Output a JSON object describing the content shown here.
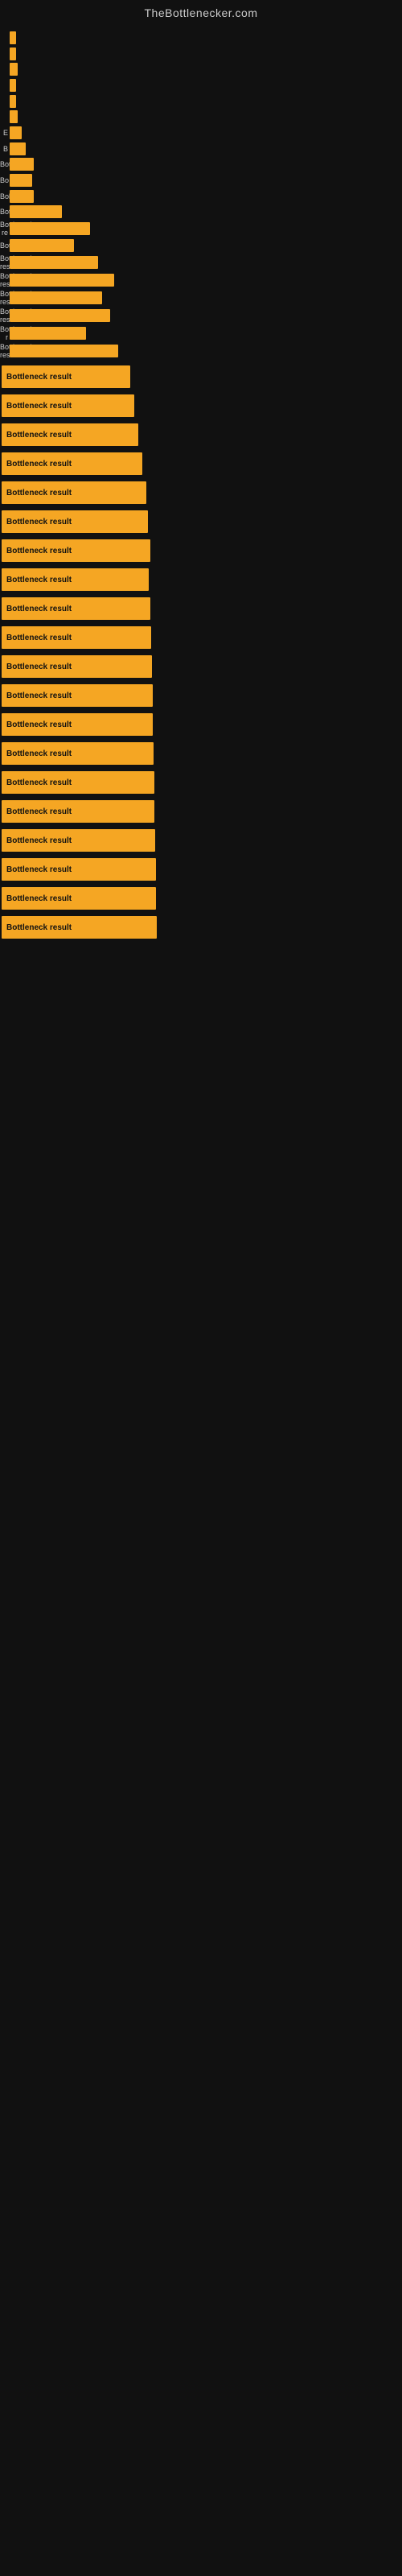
{
  "site": {
    "title": "TheBottlenecker.com"
  },
  "chart": {
    "bars": [
      {
        "label": "",
        "width": 8,
        "text": ""
      },
      {
        "label": "",
        "width": 8,
        "text": ""
      },
      {
        "label": "",
        "width": 10,
        "text": ""
      },
      {
        "label": "",
        "width": 8,
        "text": ""
      },
      {
        "label": "",
        "width": 8,
        "text": ""
      },
      {
        "label": "",
        "width": 10,
        "text": ""
      },
      {
        "label": "E",
        "width": 15,
        "text": ""
      },
      {
        "label": "B",
        "width": 20,
        "text": ""
      },
      {
        "label": "Bot",
        "width": 30,
        "text": ""
      },
      {
        "label": "Bo",
        "width": 28,
        "text": ""
      },
      {
        "label": "Bol",
        "width": 30,
        "text": ""
      },
      {
        "label": "Bottlene",
        "width": 65,
        "text": ""
      },
      {
        "label": "Bottleneck re",
        "width": 100,
        "text": ""
      },
      {
        "label": "Bottlenec",
        "width": 80,
        "text": ""
      },
      {
        "label": "Bottleneck res",
        "width": 110,
        "text": ""
      },
      {
        "label": "Bottleneck result",
        "width": 130,
        "text": ""
      },
      {
        "label": "Bottleneck res",
        "width": 115,
        "text": ""
      },
      {
        "label": "Bottleneck resul",
        "width": 125,
        "text": ""
      },
      {
        "label": "Bottleneck r",
        "width": 95,
        "text": ""
      },
      {
        "label": "Bottleneck result",
        "width": 135,
        "text": ""
      }
    ]
  },
  "results": [
    {
      "label": "Bottleneck result",
      "width": 160
    },
    {
      "label": "Bottleneck result",
      "width": 165
    },
    {
      "label": "Bottleneck result",
      "width": 170
    },
    {
      "label": "Bottleneck result",
      "width": 175
    },
    {
      "label": "Bottleneck result",
      "width": 180
    },
    {
      "label": "Bottleneck result",
      "width": 182
    },
    {
      "label": "Bottleneck result",
      "width": 185
    },
    {
      "label": "Bottleneck result",
      "width": 183
    },
    {
      "label": "Bottleneck result",
      "width": 185
    },
    {
      "label": "Bottleneck result",
      "width": 186
    },
    {
      "label": "Bottleneck result",
      "width": 187
    },
    {
      "label": "Bottleneck result",
      "width": 188
    },
    {
      "label": "Bottleneck result",
      "width": 188
    },
    {
      "label": "Bottleneck result",
      "width": 189
    },
    {
      "label": "Bottleneck result",
      "width": 190
    },
    {
      "label": "Bottleneck result",
      "width": 190
    },
    {
      "label": "Bottleneck result",
      "width": 191
    },
    {
      "label": "Bottleneck result",
      "width": 192
    },
    {
      "label": "Bottleneck result",
      "width": 192
    },
    {
      "label": "Bottleneck result",
      "width": 193
    }
  ]
}
